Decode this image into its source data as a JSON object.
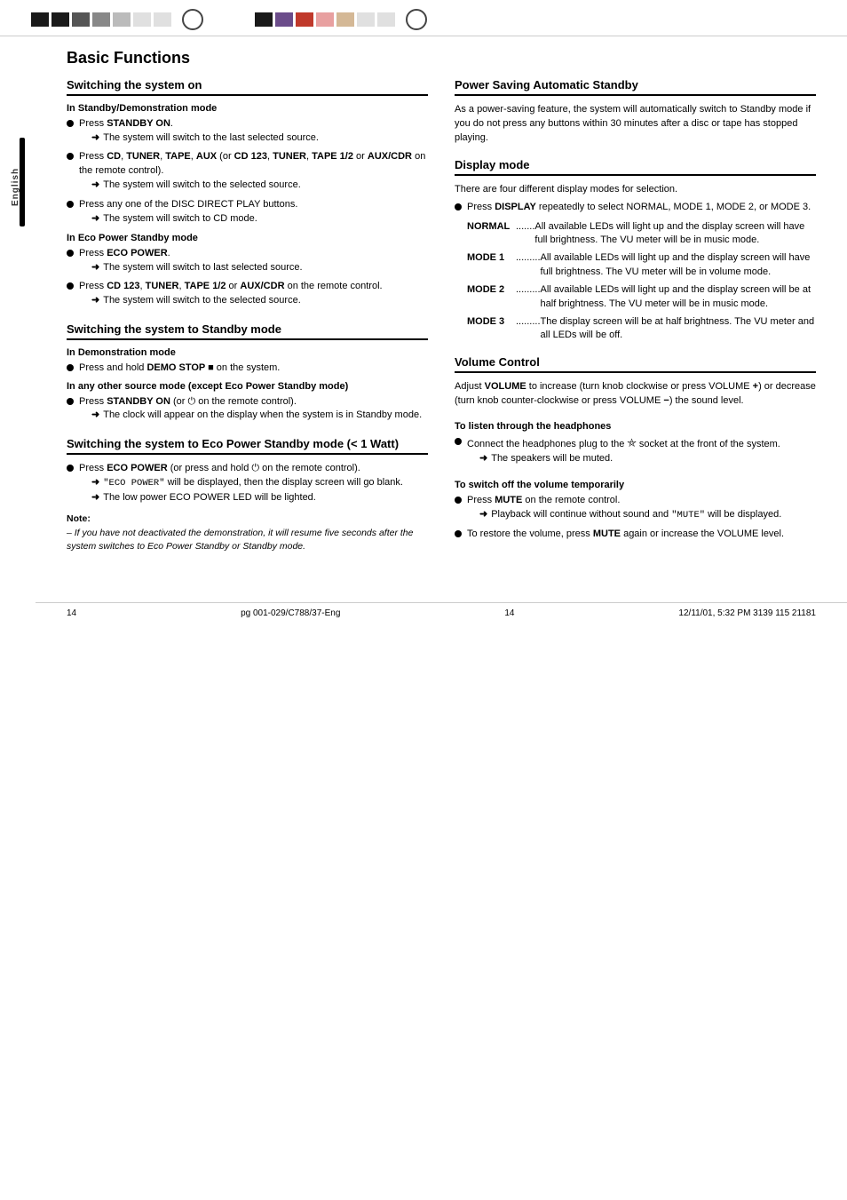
{
  "page": {
    "title": "Basic Functions",
    "page_number": "14",
    "footer_left": "pg 001-029/C788/37-Eng",
    "footer_center": "14",
    "footer_right": "12/11/01, 5:32 PM  3139 115 21181",
    "sidebar_label": "English"
  },
  "left_column": {
    "section1": {
      "title": "Switching the system on",
      "subsection1": {
        "label": "In Standby/Demonstration mode",
        "items": [
          {
            "bullet": true,
            "text": "Press STANDBY ON.",
            "arrow": "The system will switch to the last selected source."
          },
          {
            "bullet": true,
            "text": "Press CD, TUNER, TAPE, AUX (or CD 123, TUNER, TAPE 1/2 or AUX/CDR on the remote control).",
            "arrow": "The system will switch to the selected source."
          },
          {
            "bullet": true,
            "text": "Press any one of the DISC DIRECT PLAY buttons.",
            "arrow": "The system will switch to CD mode."
          }
        ]
      },
      "subsection2": {
        "label": "In Eco Power Standby mode",
        "items": [
          {
            "bullet": true,
            "text": "Press ECO POWER.",
            "arrow": "The system will switch to last selected source."
          },
          {
            "bullet": true,
            "text": "Press CD 123, TUNER, TAPE 1/2 or AUX/CDR on the remote control.",
            "arrow": "The system will switch to the selected source."
          }
        ]
      }
    },
    "section2": {
      "title": "Switching the system to Standby mode",
      "subsection1": {
        "label": "In Demonstration mode",
        "items": [
          {
            "bullet": true,
            "text": "Press and hold DEMO STOP ■ on the system."
          }
        ]
      },
      "subsection2": {
        "label": "In any other source mode (except Eco Power Standby mode)",
        "items": [
          {
            "bullet": true,
            "text": "Press STANDBY ON (or ⏻ on the remote control).",
            "arrow": "The clock will appear on the display when the system is in Standby mode."
          }
        ]
      }
    },
    "section3": {
      "title": "Switching the system to Eco Power Standby mode (< 1 Watt)",
      "items": [
        {
          "bullet": true,
          "text": "Press ECO POWER (or press and hold ⏻ on the remote control).",
          "arrows": [
            "\"ECO POWER\" will be displayed, then the display screen will go blank.",
            "The low power ECO POWER LED will be lighted."
          ]
        }
      ],
      "note": {
        "label": "Note:",
        "text": "– If you have not deactivated the demonstration, it will resume five seconds after the system switches to Eco Power Standby or Standby mode."
      }
    }
  },
  "right_column": {
    "section1": {
      "title": "Power Saving Automatic Standby",
      "text": "As a power-saving feature, the system will automatically switch to Standby mode if you do not press any buttons within 30 minutes after a disc or tape has stopped playing."
    },
    "section2": {
      "title": "Display mode",
      "intro": "There are four different display modes for selection.",
      "items": [
        {
          "bullet": true,
          "text": "Press DISPLAY repeatedly to select NORMAL, MODE 1, MODE 2, or MODE 3."
        }
      ],
      "modes": [
        {
          "label": "NORMAL",
          "dots": "........",
          "text": "All available LEDs will light up and the display screen will have full brightness. The VU meter will be in music mode."
        },
        {
          "label": "MODE 1",
          "dots": "..........",
          "text": "All available LEDs will light up and the display screen will have full brightness. The VU meter will be in volume mode."
        },
        {
          "label": "MODE 2",
          "dots": "..........",
          "text": "All available LEDs will light up and the display screen will be at half brightness. The VU meter will be in music mode."
        },
        {
          "label": "MODE 3",
          "dots": "..........",
          "text": "The display screen will be at half brightness. The VU meter and all LEDs will be off."
        }
      ]
    },
    "section3": {
      "title": "Volume Control",
      "text": "Adjust VOLUME to increase (turn knob clockwise or press VOLUME +) or decrease (turn knob counter-clockwise or press VOLUME −) the sound level."
    },
    "section4": {
      "title": "To listen through the headphones",
      "items": [
        {
          "bullet": true,
          "text": "Connect the headphones plug to the 🎧 socket at the front of the system.",
          "arrow": "The speakers will be muted."
        }
      ]
    },
    "section5": {
      "title": "To switch off the volume temporarily",
      "items": [
        {
          "bullet": true,
          "text": "Press MUTE on the remote control.",
          "arrows": [
            "Playback will continue without sound and \"MUTE\" will be displayed."
          ]
        },
        {
          "bullet": true,
          "text": "To restore the volume, press MUTE again or increase the VOLUME level."
        }
      ]
    }
  }
}
